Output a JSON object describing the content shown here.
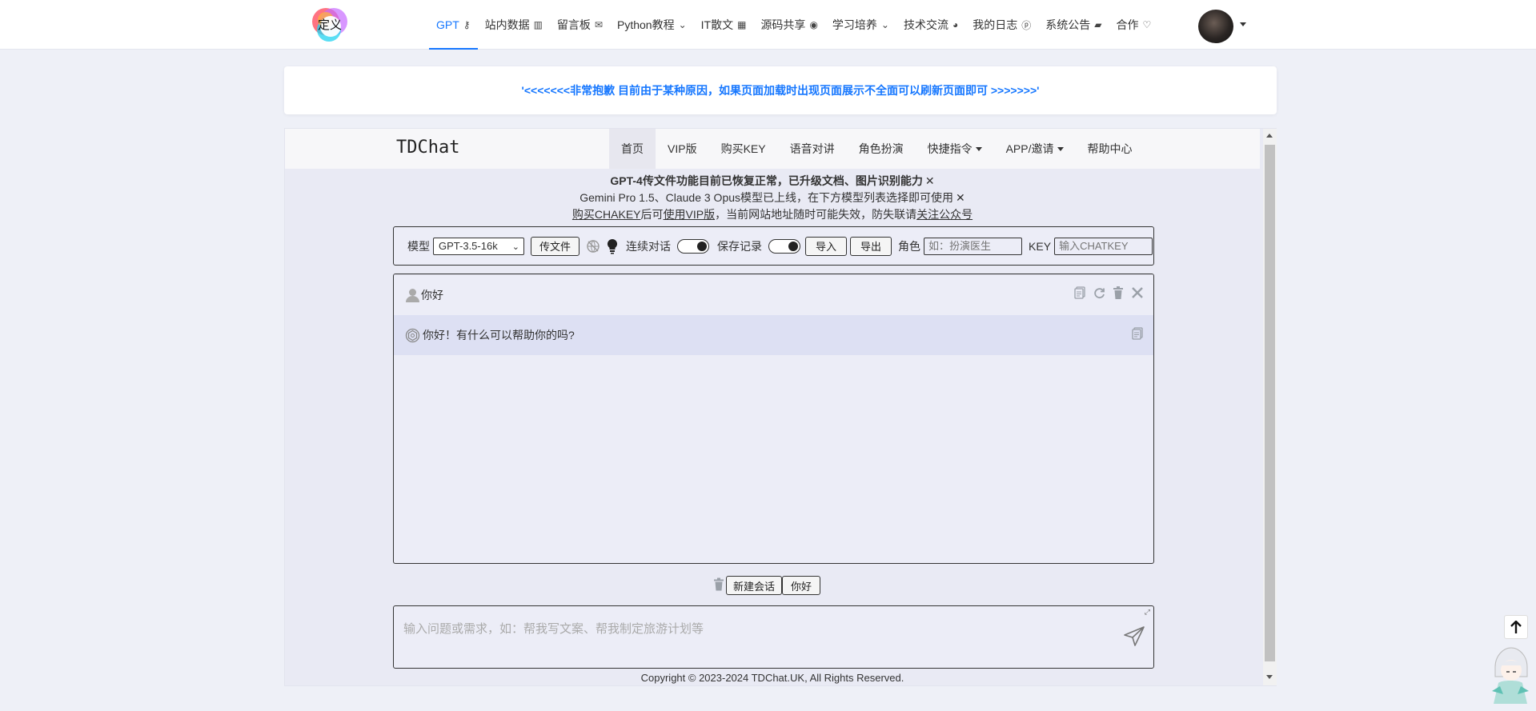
{
  "logo": {
    "text": "定义"
  },
  "nav": [
    {
      "label": "GPT",
      "icon": "key-icon",
      "glyph": "⚷",
      "active": true
    },
    {
      "label": "站内数据",
      "icon": "chart-icon",
      "glyph": "▥"
    },
    {
      "label": "留言板",
      "icon": "mail-icon",
      "glyph": "✉"
    },
    {
      "label": "Python教程",
      "icon": "chevron-down-icon",
      "glyph": "⌄"
    },
    {
      "label": "IT散文",
      "icon": "qrcode-icon",
      "glyph": "▦"
    },
    {
      "label": "源码共享",
      "icon": "globe-icon",
      "glyph": "◉"
    },
    {
      "label": "学习培养",
      "icon": "chevron-down-icon",
      "glyph": "⌄"
    },
    {
      "label": "技术交流",
      "icon": "github-icon",
      "glyph": "◕"
    },
    {
      "label": "我的日志",
      "icon": "pinterest-icon",
      "glyph": "ⓟ"
    },
    {
      "label": "系统公告",
      "icon": "comments-icon",
      "glyph": "▰"
    },
    {
      "label": "合作",
      "icon": "lightbulb-icon",
      "glyph": "♡"
    }
  ],
  "notice": "'<<<<<<<非常抱歉 目前由于某种原因，如果页面加载时出现页面展示不全面可以刷新页面即可 >>>>>>>'",
  "app": {
    "brand": "TDChat",
    "tabs": [
      {
        "label": "首页",
        "active": true
      },
      {
        "label": "VIP版"
      },
      {
        "label": "购买KEY"
      },
      {
        "label": "语音对讲"
      },
      {
        "label": "角色扮演"
      },
      {
        "label": "快捷指令",
        "dropdown": true
      },
      {
        "label": "APP/邀请",
        "dropdown": true
      },
      {
        "label": "帮助中心"
      }
    ],
    "announce": {
      "line1": "GPT-4传文件功能目前已恢复正常，已升级文档、图片识别能力",
      "line2": "Gemini Pro 1.5、Claude 3 Opus模型已上线，在下方模型列表选择即可使用",
      "line3_link1": "购买CHAKEY",
      "line3_mid1": "后可",
      "line3_link2": "使用VIP版",
      "line3_mid2": "，当前网站地址随时可能失效，防失联请",
      "line3_link3": "关注公众号",
      "close": "✕"
    },
    "toolbar": {
      "model_label": "模型",
      "model_value": "GPT-3.5-16k",
      "upload_button": "传文件",
      "continuous_label": "连续对话",
      "save_label": "保存记录",
      "import_button": "导入",
      "export_button": "导出",
      "role_label": "角色",
      "role_placeholder": "如：扮演医生",
      "key_label": "KEY",
      "key_placeholder": "输入CHATKEY"
    },
    "messages": [
      {
        "role": "user",
        "text": "你好"
      },
      {
        "role": "assistant",
        "text": "你好！有什么可以帮助你的吗?"
      }
    ],
    "bottom": {
      "new_chat": "新建会话",
      "session_tab": "你好"
    },
    "composer_placeholder": "输入问题或需求，如：帮我写文案、帮我制定旅游计划等",
    "footer": "Copyright © 2023-2024 TDChat.UK, All Rights Reserved."
  },
  "colors": {
    "accent": "#1677ff",
    "bg": "#eef0f7",
    "panel": "#ecedf7",
    "bot_bubble": "#dde0f3"
  }
}
